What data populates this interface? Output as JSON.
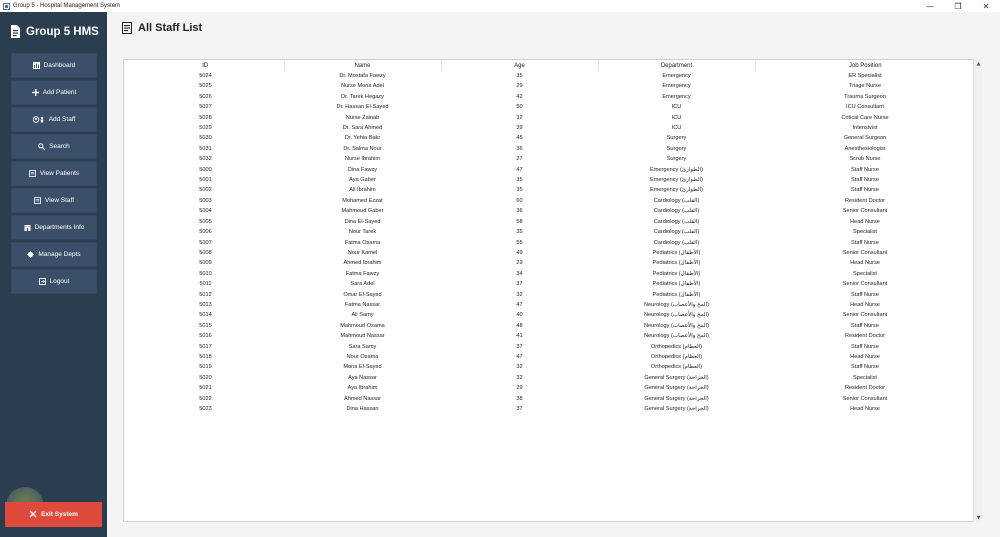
{
  "window": {
    "title": "Group 5 - Hospital Management System",
    "controls": [
      "—",
      "❐",
      "✕"
    ]
  },
  "sidebar": {
    "brand": "Group 5 HMS",
    "items": [
      {
        "label": "Dashboard",
        "icon": "chart-icon"
      },
      {
        "label": "Add Patient",
        "icon": "plus-icon"
      },
      {
        "label": "Add Staff",
        "icon": "staff-icon"
      },
      {
        "label": "Search",
        "icon": "search-icon"
      },
      {
        "label": "View Patients",
        "icon": "list-icon"
      },
      {
        "label": "View Staff",
        "icon": "list-icon"
      },
      {
        "label": "Departments Info",
        "icon": "building-icon"
      },
      {
        "label": "Manage Depts",
        "icon": "gear-icon"
      },
      {
        "label": "Logout",
        "icon": "logout-icon"
      }
    ],
    "exit_label": "Exit System"
  },
  "main": {
    "title": "All Staff List",
    "columns": [
      "ID",
      "Name",
      "Age",
      "Department",
      "Job Position"
    ],
    "rows": [
      [
        "5024",
        "Dr. Mostafa Fawzy",
        "35",
        "Emergency",
        "ER Specialist"
      ],
      [
        "5025",
        "Nurse Mona Adel",
        "29",
        "Emergency",
        "Triage Nurse"
      ],
      [
        "5026",
        "Dr. Tarek Hegazy",
        "42",
        "Emergency",
        "Trauma Surgeon"
      ],
      [
        "5027",
        "Dr. Hassan El-Sayed",
        "50",
        "ICU",
        "ICU Consultant"
      ],
      [
        "5028",
        "Nurse Zainab",
        "32",
        "ICU",
        "Critical Care Nurse"
      ],
      [
        "5029",
        "Dr. Sara Ahmed",
        "39",
        "ICU",
        "Intensivist"
      ],
      [
        "5030",
        "Dr. Yehia Bakr",
        "45",
        "Surgery",
        "General Surgeon"
      ],
      [
        "5031",
        "Dr. Salma Nour",
        "36",
        "Surgery",
        "Anesthesiologist"
      ],
      [
        "5032",
        "Nurse Ibrahim",
        "27",
        "Surgery",
        "Scrub Nurse"
      ],
      [
        "5000",
        "Dina Fawzy",
        "47",
        "Emergency (الطوارئ)",
        "Staff Nurse"
      ],
      [
        "5001",
        "Aya Gaber",
        "35",
        "Emergency (الطوارئ)",
        "Staff Nurse"
      ],
      [
        "5002",
        "Ali Ibrahim",
        "35",
        "Emergency (الطوارئ)",
        "Staff Nurse"
      ],
      [
        "5003",
        "Mohamed Ezzat",
        "60",
        "Cardiology (القلب)",
        "Resident Doctor"
      ],
      [
        "5004",
        "Mahmoud Gaber",
        "36",
        "Cardiology (القلب)",
        "Senior Consultant"
      ],
      [
        "5005",
        "Dina El-Sayed",
        "58",
        "Cardiology (القلب)",
        "Head Nurse"
      ],
      [
        "5006",
        "Nour Tarek",
        "35",
        "Cardiology (القلب)",
        "Specialist"
      ],
      [
        "5007",
        "Fatma Osama",
        "55",
        "Cardiology (القلب)",
        "Staff Nurse"
      ],
      [
        "5008",
        "Nour Kamel",
        "49",
        "Pediatrics (الأطفال)",
        "Senior Consultant"
      ],
      [
        "5009",
        "Ahmed Ibrahim",
        "29",
        "Pediatrics (الأطفال)",
        "Head Nurse"
      ],
      [
        "5010",
        "Fatma Fawzy",
        "34",
        "Pediatrics (الأطفال)",
        "Specialist"
      ],
      [
        "5011",
        "Sara Adel",
        "37",
        "Pediatrics (الأطفال)",
        "Senior Consultant"
      ],
      [
        "5012",
        "Omar El-Sayed",
        "32",
        "Pediatrics (الأطفال)",
        "Staff Nurse"
      ],
      [
        "5013",
        "Fatma Nassar",
        "47",
        "Neurology (المخ والأعصاب)",
        "Head Nurse"
      ],
      [
        "5014",
        "Ali Samy",
        "40",
        "Neurology (المخ والأعصاب)",
        "Senior Consultant"
      ],
      [
        "5015",
        "Mahmoud Osama",
        "48",
        "Neurology (المخ والأعصاب)",
        "Staff Nurse"
      ],
      [
        "5016",
        "Mahmoud Nassar",
        "41",
        "Neurology (المخ والأعصاب)",
        "Resident Doctor"
      ],
      [
        "5017",
        "Sara Samy",
        "37",
        "Orthopedics (العظام)",
        "Staff Nurse"
      ],
      [
        "5018",
        "Nour Osama",
        "47",
        "Orthopedics (العظام)",
        "Head Nurse"
      ],
      [
        "5019",
        "Mona El-Sayed",
        "32",
        "Orthopedics (العظام)",
        "Staff Nurse"
      ],
      [
        "5020",
        "Aya Nassar",
        "32",
        "General Surgery (الجراحة)",
        "Specialist"
      ],
      [
        "5021",
        "Aya Ibrahim",
        "29",
        "General Surgery (الجراحة)",
        "Resident Doctor"
      ],
      [
        "5022",
        "Ahmed Nassar",
        "38",
        "General Surgery (الجراحة)",
        "Senior Consultant"
      ],
      [
        "5023",
        "Dina Hassan",
        "37",
        "General Surgery (الجراحة)",
        "Head Nurse"
      ]
    ]
  },
  "colors": {
    "sidebar_bg": "#2b3e50",
    "nav_item_bg": "#3b5068",
    "exit_bg": "#e04a3c"
  }
}
